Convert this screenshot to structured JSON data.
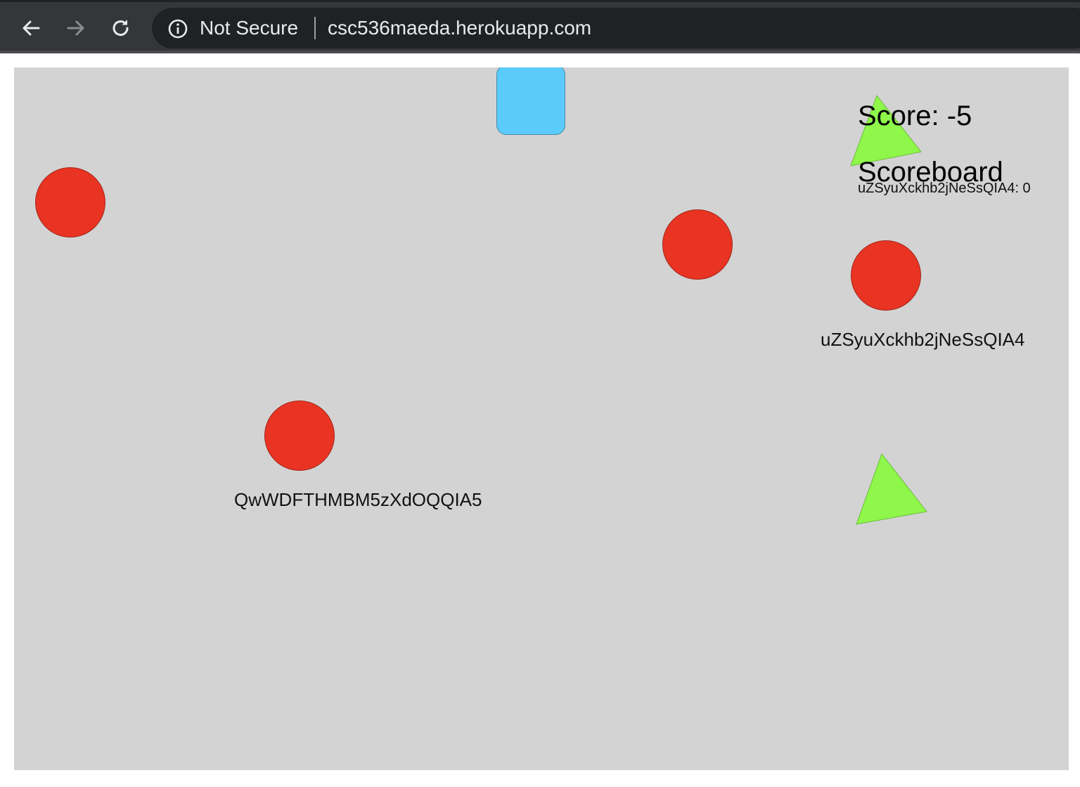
{
  "browser": {
    "back_icon": "arrow-left-icon",
    "forward_icon": "arrow-right-icon",
    "reload_icon": "reload-icon",
    "security_icon": "info-circle-icon",
    "security_label": "Not Secure",
    "url": "csc536maeda.herokuapp.com"
  },
  "game": {
    "score_text": "Score: -5",
    "scoreboard": {
      "title": "Scoreboard",
      "entries": [
        "uZSyuXckhb2jNeSsQIA4: 0"
      ]
    },
    "player_labels": [
      "uZSyuXckhb2jNeSsQIA4",
      "QwWDFTHMBM5zXdOQQIA5"
    ],
    "colors": {
      "background": "#d3d3d3",
      "circle": "#e93423",
      "square": "#5bcbfb",
      "triangle": "#8ef74a"
    }
  }
}
